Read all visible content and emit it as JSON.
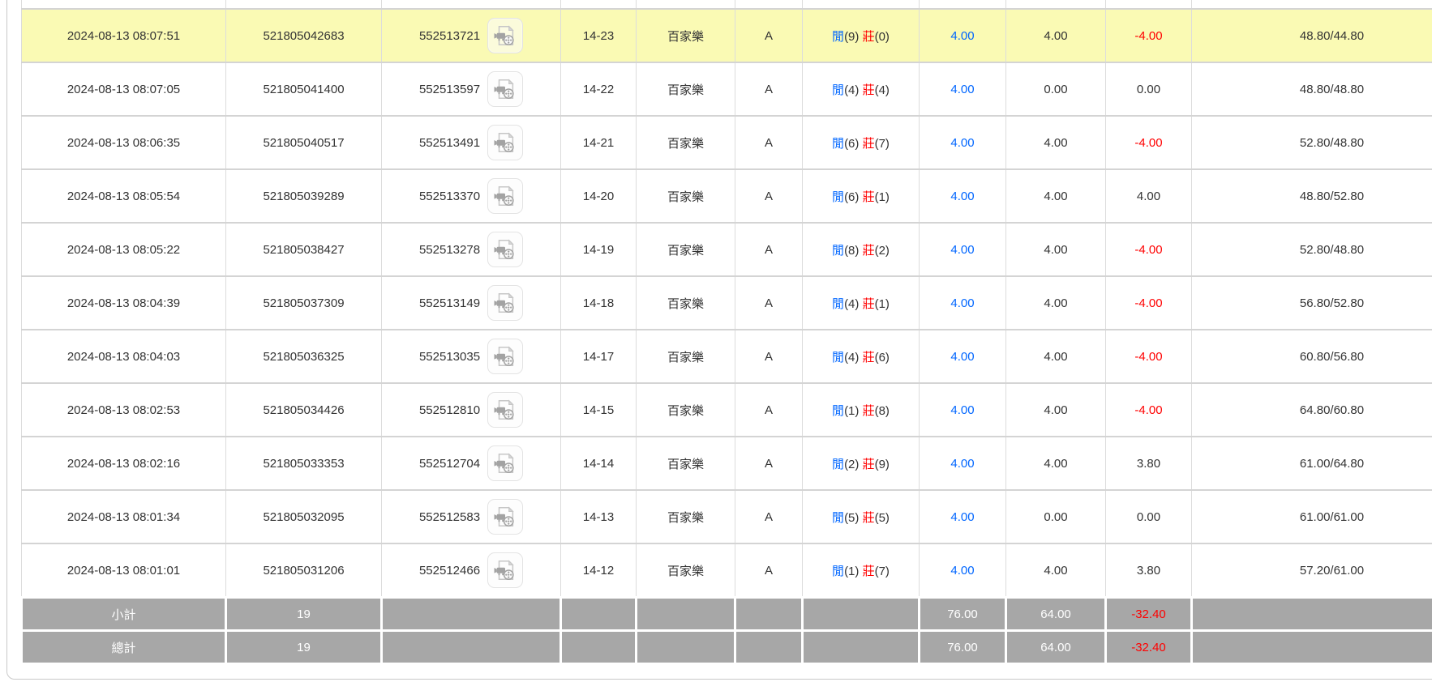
{
  "labels": {
    "player": "閒",
    "banker": "莊",
    "game": "百家樂",
    "subtotal": "小計",
    "total": "總計"
  },
  "colors": {
    "highlight_row": "#fafab4",
    "bet_link_blue": "#0066ff",
    "player_blue": "#0066ff",
    "banker_red": "#ff0000",
    "loss_red": "#ff0000",
    "footer_gray": "#a7a7a7",
    "text": "#333333"
  },
  "icons": {
    "replay": "video-replay-icon"
  },
  "table": {
    "rows": [
      {
        "time": "2024-08-13 08:07:51",
        "order_id": "521805042683",
        "round_id": "552513721",
        "shoe_round": "14-23",
        "game": "百家樂",
        "table": "A",
        "player_score": "(9)",
        "banker_score": "(0)",
        "bet": "4.00",
        "valid": "4.00",
        "winloss": "-4.00",
        "winloss_negative": true,
        "balance": "48.80/44.80",
        "highlighted": true
      },
      {
        "time": "2024-08-13 08:07:05",
        "order_id": "521805041400",
        "round_id": "552513597",
        "shoe_round": "14-22",
        "game": "百家樂",
        "table": "A",
        "player_score": "(4)",
        "banker_score": "(4)",
        "bet": "4.00",
        "valid": "0.00",
        "winloss": "0.00",
        "winloss_negative": false,
        "balance": "48.80/48.80",
        "highlighted": false
      },
      {
        "time": "2024-08-13 08:06:35",
        "order_id": "521805040517",
        "round_id": "552513491",
        "shoe_round": "14-21",
        "game": "百家樂",
        "table": "A",
        "player_score": "(6)",
        "banker_score": "(7)",
        "bet": "4.00",
        "valid": "4.00",
        "winloss": "-4.00",
        "winloss_negative": true,
        "balance": "52.80/48.80",
        "highlighted": false
      },
      {
        "time": "2024-08-13 08:05:54",
        "order_id": "521805039289",
        "round_id": "552513370",
        "shoe_round": "14-20",
        "game": "百家樂",
        "table": "A",
        "player_score": "(6)",
        "banker_score": "(1)",
        "bet": "4.00",
        "valid": "4.00",
        "winloss": "4.00",
        "winloss_negative": false,
        "balance": "48.80/52.80",
        "highlighted": false
      },
      {
        "time": "2024-08-13 08:05:22",
        "order_id": "521805038427",
        "round_id": "552513278",
        "shoe_round": "14-19",
        "game": "百家樂",
        "table": "A",
        "player_score": "(8)",
        "banker_score": "(2)",
        "bet": "4.00",
        "valid": "4.00",
        "winloss": "-4.00",
        "winloss_negative": true,
        "balance": "52.80/48.80",
        "highlighted": false
      },
      {
        "time": "2024-08-13 08:04:39",
        "order_id": "521805037309",
        "round_id": "552513149",
        "shoe_round": "14-18",
        "game": "百家樂",
        "table": "A",
        "player_score": "(4)",
        "banker_score": "(1)",
        "bet": "4.00",
        "valid": "4.00",
        "winloss": "-4.00",
        "winloss_negative": true,
        "balance": "56.80/52.80",
        "highlighted": false
      },
      {
        "time": "2024-08-13 08:04:03",
        "order_id": "521805036325",
        "round_id": "552513035",
        "shoe_round": "14-17",
        "game": "百家樂",
        "table": "A",
        "player_score": "(4)",
        "banker_score": "(6)",
        "bet": "4.00",
        "valid": "4.00",
        "winloss": "-4.00",
        "winloss_negative": true,
        "balance": "60.80/56.80",
        "highlighted": false
      },
      {
        "time": "2024-08-13 08:02:53",
        "order_id": "521805034426",
        "round_id": "552512810",
        "shoe_round": "14-15",
        "game": "百家樂",
        "table": "A",
        "player_score": "(1)",
        "banker_score": "(8)",
        "bet": "4.00",
        "valid": "4.00",
        "winloss": "-4.00",
        "winloss_negative": true,
        "balance": "64.80/60.80",
        "highlighted": false
      },
      {
        "time": "2024-08-13 08:02:16",
        "order_id": "521805033353",
        "round_id": "552512704",
        "shoe_round": "14-14",
        "game": "百家樂",
        "table": "A",
        "player_score": "(2)",
        "banker_score": "(9)",
        "bet": "4.00",
        "valid": "4.00",
        "winloss": "3.80",
        "winloss_negative": false,
        "balance": "61.00/64.80",
        "highlighted": false
      },
      {
        "time": "2024-08-13 08:01:34",
        "order_id": "521805032095",
        "round_id": "552512583",
        "shoe_round": "14-13",
        "game": "百家樂",
        "table": "A",
        "player_score": "(5)",
        "banker_score": "(5)",
        "bet": "4.00",
        "valid": "0.00",
        "winloss": "0.00",
        "winloss_negative": false,
        "balance": "61.00/61.00",
        "highlighted": false
      },
      {
        "time": "2024-08-13 08:01:01",
        "order_id": "521805031206",
        "round_id": "552512466",
        "shoe_round": "14-12",
        "game": "百家樂",
        "table": "A",
        "player_score": "(1)",
        "banker_score": "(7)",
        "bet": "4.00",
        "valid": "4.00",
        "winloss": "3.80",
        "winloss_negative": false,
        "balance": "57.20/61.00",
        "highlighted": false
      }
    ],
    "footer_rows": [
      {
        "label": "小計",
        "count": "19",
        "bet": "76.00",
        "valid": "64.00",
        "winloss": "-32.40",
        "winloss_negative": true
      },
      {
        "label": "總計",
        "count": "19",
        "bet": "76.00",
        "valid": "64.00",
        "winloss": "-32.40",
        "winloss_negative": true
      }
    ]
  }
}
